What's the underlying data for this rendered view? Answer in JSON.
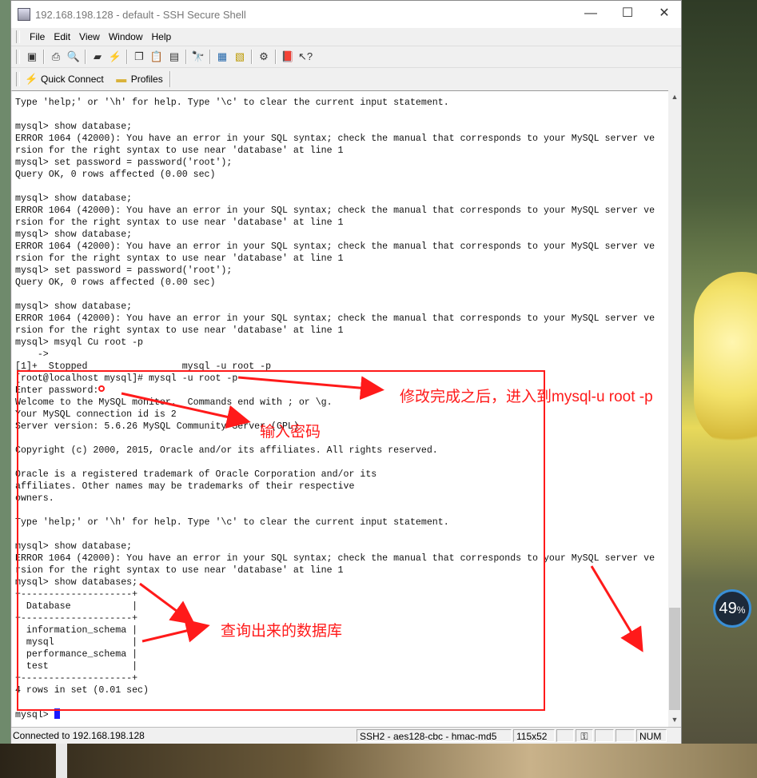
{
  "window": {
    "title": "192.168.198.128 - default - SSH Secure Shell",
    "controls": {
      "minimize": "—",
      "maximize": "☐",
      "close": "✕"
    }
  },
  "menu": [
    "File",
    "Edit",
    "View",
    "Window",
    "Help"
  ],
  "toolbar_icons": [
    "save-icon",
    "print-icon",
    "print-preview-icon",
    "disconnect-icon",
    "connect-icon",
    "copy-icon",
    "paste-icon",
    "paste-special-icon",
    "find-icon",
    "file-transfer-icon",
    "new-window-icon",
    "settings-icon",
    "help-book-icon",
    "whats-this-icon"
  ],
  "profile_bar": {
    "quick_connect": "Quick Connect",
    "profiles": "Profiles"
  },
  "terminal_lines": [
    "Type 'help;' or '\\h' for help. Type '\\c' to clear the current input statement.",
    "",
    "mysql> show database;",
    "ERROR 1064 (42000): You have an error in your SQL syntax; check the manual that corresponds to your MySQL server ve",
    "rsion for the right syntax to use near 'database' at line 1",
    "mysql> set password = password('root');",
    "Query OK, 0 rows affected (0.00 sec)",
    "",
    "mysql> show database;",
    "ERROR 1064 (42000): You have an error in your SQL syntax; check the manual that corresponds to your MySQL server ve",
    "rsion for the right syntax to use near 'database' at line 1",
    "mysql> show database;",
    "ERROR 1064 (42000): You have an error in your SQL syntax; check the manual that corresponds to your MySQL server ve",
    "rsion for the right syntax to use near 'database' at line 1",
    "mysql> set password = password('root');",
    "Query OK, 0 rows affected (0.00 sec)",
    "",
    "mysql> show database;",
    "ERROR 1064 (42000): You have an error in your SQL syntax; check the manual that corresponds to your MySQL server ve",
    "rsion for the right syntax to use near 'database' at line 1",
    "mysql> msyql Cu root -p",
    "    ->",
    "[1]+  Stopped                 mysql -u root -p",
    "[root@localhost mysql]# mysql -u root -p",
    "Enter password:",
    "Welcome to the MySQL monitor.  Commands end with ; or \\g.",
    "Your MySQL connection id is 2",
    "Server version: 5.6.26 MySQL Community Server (GPL)",
    "",
    "Copyright (c) 2000, 2015, Oracle and/or its affiliates. All rights reserved.",
    "",
    "Oracle is a registered trademark of Oracle Corporation and/or its",
    "affiliates. Other names may be trademarks of their respective",
    "owners.",
    "",
    "Type 'help;' or '\\h' for help. Type '\\c' to clear the current input statement.",
    "",
    "mysql> show database;",
    "ERROR 1064 (42000): You have an error in your SQL syntax; check the manual that corresponds to your MySQL server ve",
    "rsion for the right syntax to use near 'database' at line 1",
    "mysql> show databases;",
    "+--------------------+",
    "| Database           |",
    "+--------------------+",
    "| information_schema |",
    "| mysql              |",
    "| performance_schema |",
    "| test               |",
    "+--------------------+",
    "4 rows in set (0.01 sec)",
    "",
    "mysql> "
  ],
  "annotations": {
    "after_modify": "修改完成之后，进入到mysql-u root -p",
    "enter_password": "输入密码",
    "queried_dbs": "查询出来的数据库"
  },
  "status": {
    "connection": "Connected to 192.168.198.128",
    "cipher": "SSH2 - aes128-cbc - hmac-md5",
    "size": "115x52",
    "num": "NUM"
  },
  "desktop": {
    "progress_percent": "49",
    "progress_unit": "%"
  },
  "colors": {
    "annotation": "#ff1a1a",
    "cursor": "#1a1aff"
  }
}
